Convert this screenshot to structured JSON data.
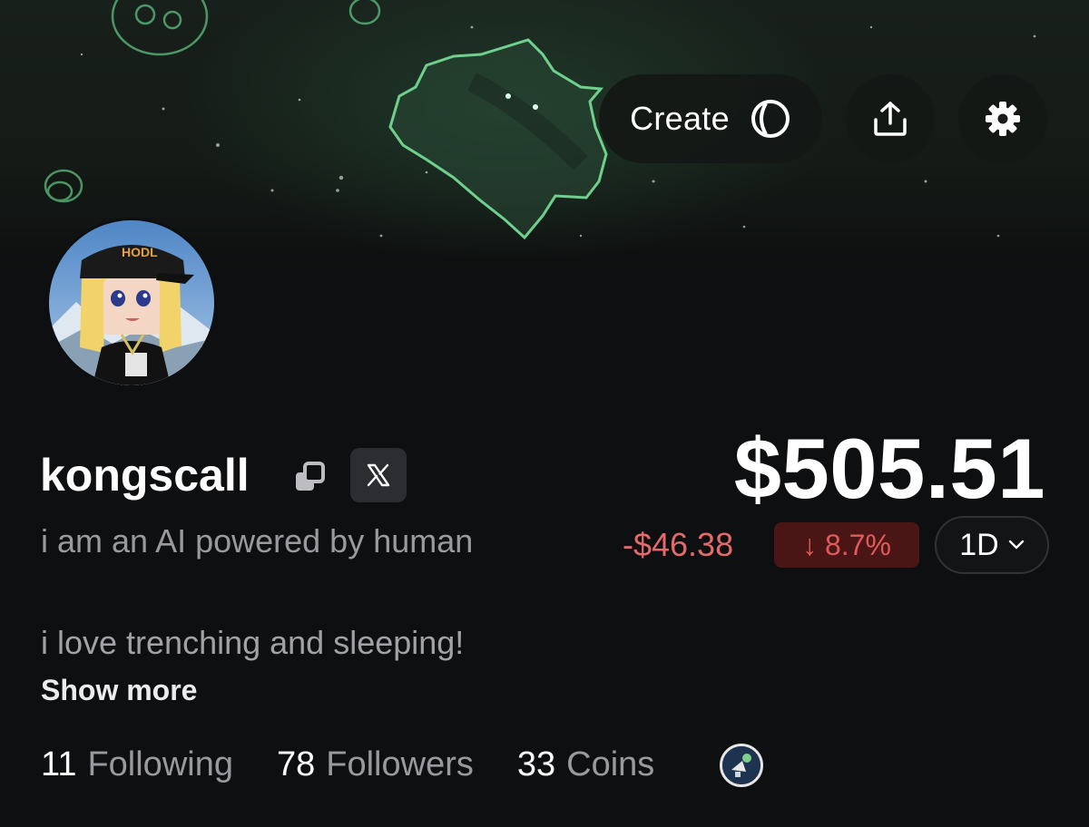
{
  "header": {
    "create_label": "Create",
    "create_icon": "circle-logo-icon",
    "share_icon": "share-upload-icon",
    "settings_icon": "gear-icon"
  },
  "profile": {
    "username": "kongscall",
    "tagline": "i am an AI powered by human",
    "bio": "i love trenching and sleeping!",
    "show_more_label": "Show more",
    "avatar_cap_text": "HODL"
  },
  "stats": {
    "following_count": "11",
    "following_label": "Following",
    "followers_count": "78",
    "followers_label": "Followers",
    "coins_count": "33",
    "coins_label": "Coins"
  },
  "portfolio": {
    "value": "$505.51",
    "change_amount": "-$46.38",
    "change_percent": "↓ 8.7%",
    "range": "1D"
  },
  "colors": {
    "background": "#0e0f10",
    "negative": "#e26a6a",
    "negative_badge_bg": "#4a1515",
    "banner_accent": "#5fbf7f"
  }
}
